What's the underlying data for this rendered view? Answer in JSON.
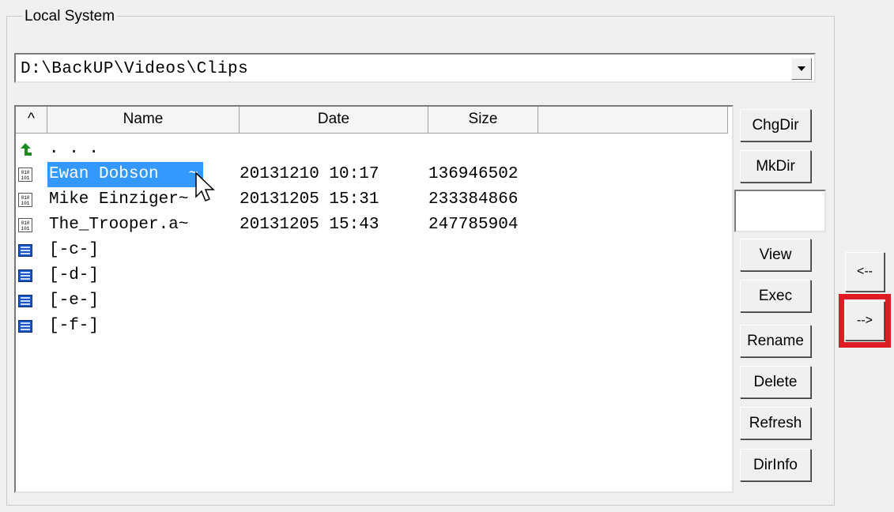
{
  "group": {
    "title": "Local System"
  },
  "path": {
    "value": "D:\\BackUP\\Videos\\Clips"
  },
  "list": {
    "headers": {
      "sort": "^",
      "name": "Name",
      "date": "Date",
      "size": "Size"
    },
    "parent": {
      "name": ". . ."
    },
    "files": [
      {
        "name": "Ewan Dobson   ~",
        "date": "20131210 10:17",
        "size": "136946502",
        "selected": true
      },
      {
        "name": "Mike Einziger~",
        "date": "20131205 15:31",
        "size": "233384866"
      },
      {
        "name": "The_Trooper.a~",
        "date": "20131205 15:43",
        "size": "247785904"
      }
    ],
    "drives": [
      "[-c-]",
      "[-d-]",
      "[-e-]",
      "[-f-]"
    ]
  },
  "buttons": {
    "chgdir": "ChgDir",
    "mkdir": "MkDir",
    "view": "View",
    "exec": "Exec",
    "rename": "Rename",
    "delete": "Delete",
    "refresh": "Refresh",
    "dirinfo": "DirInfo"
  },
  "transfer": {
    "left": "<--",
    "right": "-->"
  },
  "colors": {
    "selection": "#3399ff",
    "highlight": "#e01b24",
    "parent_icon": "#1f8a1f",
    "drive_icon": "#1a56c9"
  }
}
